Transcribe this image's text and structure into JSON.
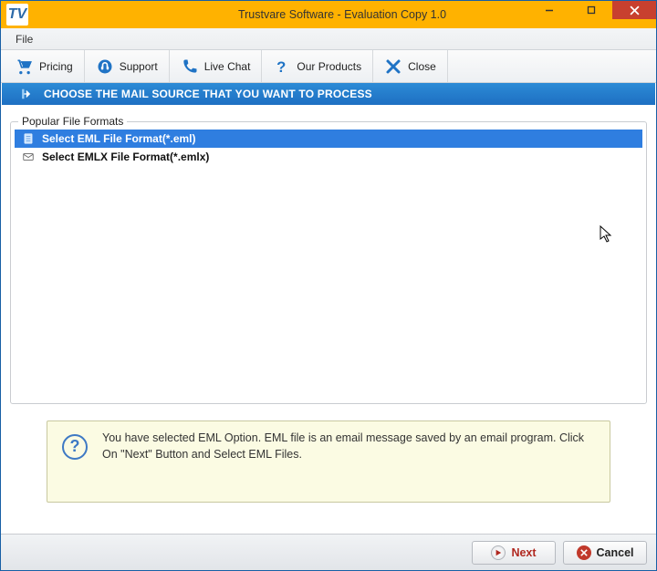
{
  "titlebar": {
    "title": "Trustvare Software - Evaluation Copy 1.0",
    "app_abbrev": "TV"
  },
  "menu": {
    "file": "File"
  },
  "toolbar": {
    "pricing": "Pricing",
    "support": "Support",
    "livechat": "Live Chat",
    "products": "Our Products",
    "close": "Close"
  },
  "section": {
    "heading": "CHOOSE THE MAIL SOURCE THAT YOU WANT TO PROCESS"
  },
  "formats": {
    "legend": "Popular File Formats",
    "items": [
      {
        "label": "Select EML File Format(*.eml)",
        "selected": true
      },
      {
        "label": "Select EMLX File Format(*.emlx)",
        "selected": false
      }
    ]
  },
  "info": {
    "text": "You have selected EML Option. EML file is an email message saved by an email program. Click On \"Next\" Button and Select EML Files."
  },
  "footer": {
    "next": "Next",
    "cancel": "Cancel"
  }
}
